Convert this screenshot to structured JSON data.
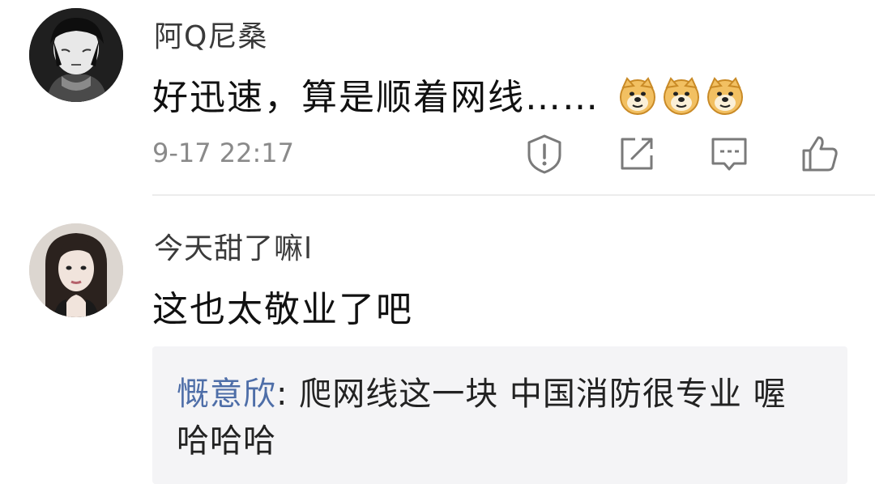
{
  "comments": [
    {
      "username": "阿Q尼桑",
      "text": "好迅速，算是顺着网线……",
      "emoji": [
        "doge-emoji",
        "doge-emoji",
        "doge-emoji"
      ],
      "timestamp": "9-17 22:17",
      "actions": [
        "report-icon",
        "share-icon",
        "reply-icon",
        "like-icon"
      ]
    },
    {
      "username": "今天甜了嘛l",
      "text": "这也太敬业了吧",
      "reply": {
        "author": "慨意欣",
        "separator": ": ",
        "text": "爬网线这一块 中国消防很专业 喔 哈哈哈"
      }
    }
  ],
  "colors": {
    "reply_author": "#4e6ea8",
    "reply_bg": "#f4f4f6",
    "meta": "#8a8a8a"
  }
}
